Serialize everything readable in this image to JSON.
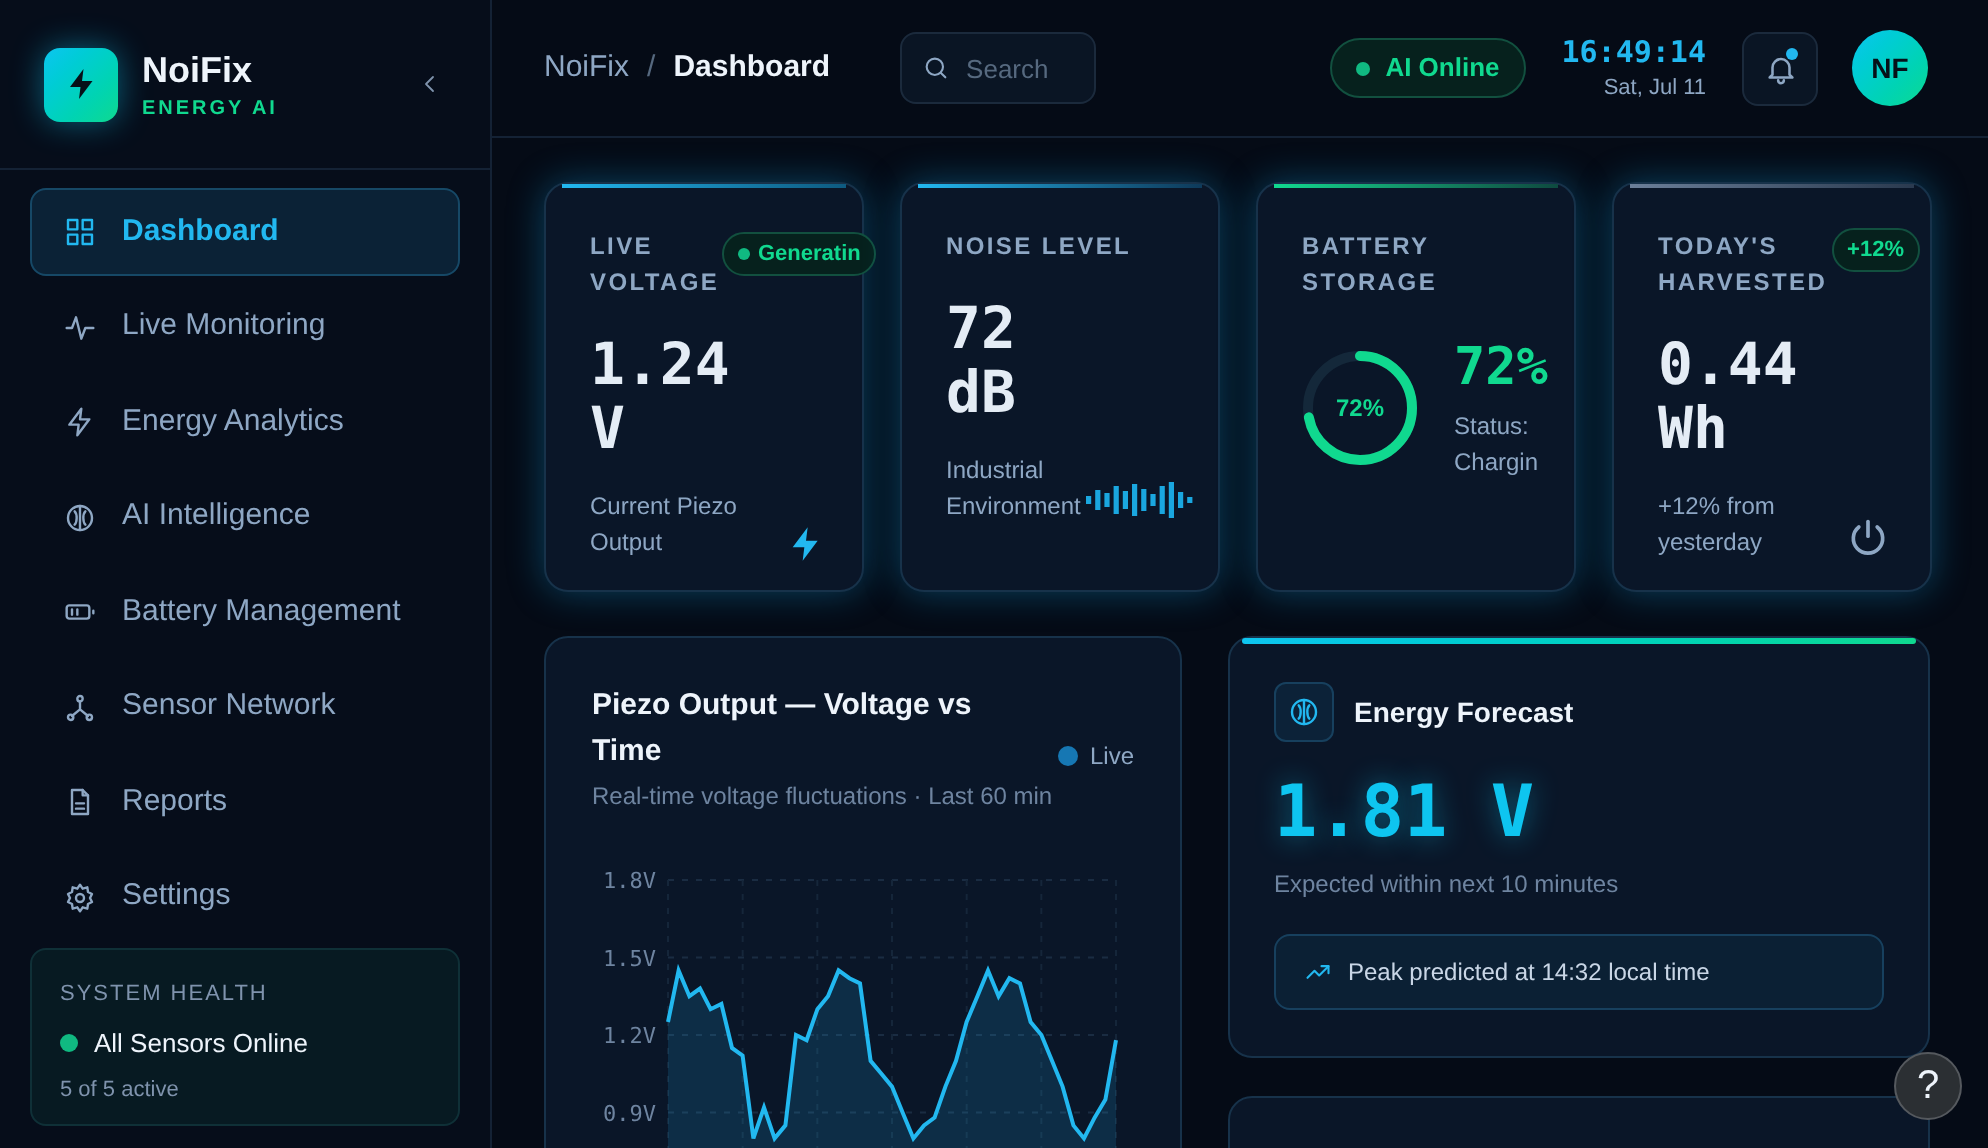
{
  "sidebar": {
    "brand": {
      "name": "NoiFix",
      "subtitle": "ENERGY AI"
    },
    "items": [
      {
        "label": "Dashboard",
        "selected": true
      },
      {
        "label": "Live Monitoring",
        "selected": false
      },
      {
        "label": "Energy Analytics",
        "selected": false
      },
      {
        "label": "AI Intelligence",
        "selected": false
      },
      {
        "label": "Battery Management",
        "selected": false
      },
      {
        "label": "Sensor Network",
        "selected": false
      },
      {
        "label": "Reports",
        "selected": false
      },
      {
        "label": "Settings",
        "selected": false
      }
    ],
    "system_health": {
      "title": "SYSTEM HEALTH",
      "status": "All Sensors Online",
      "color": "#10b981",
      "detail": "5 of 5 active"
    }
  },
  "header": {
    "breadcrumb": [
      "NoiFix",
      "/",
      "Dashboard"
    ],
    "search": {
      "placeholder": "Search"
    },
    "ai_status": "AI Online",
    "time": "16:49:14",
    "date": "Sat, Jul 11",
    "notifications": {
      "unread": true
    },
    "avatar": "NF"
  },
  "stat_cards": [
    {
      "kind": "voltage",
      "title": "LIVE VOLTAGE",
      "badge": {
        "text": "Generatin",
        "dot": true
      },
      "value": "1.24 V",
      "note": "Current Piezo Output"
    },
    {
      "kind": "noise",
      "title": "NOISE LEVEL",
      "value": "72 dB",
      "note": "Industrial Environment"
    },
    {
      "kind": "battery",
      "title": "BATTERY STORAGE",
      "level": 0.72,
      "ring_label": "72%",
      "value": "72%",
      "note": "Status: Chargin"
    },
    {
      "kind": "harvested",
      "title": "TODAY'S HARVESTED",
      "badge": {
        "text": "+12%",
        "dot": false
      },
      "value": "0.44 Wh",
      "note": "+12% from yesterday"
    }
  ],
  "voltage_chart": {
    "title": "Piezo Output — Voltage vs Time",
    "subtitle": "Real-time voltage fluctuations · Last 60 min",
    "chart_data": {
      "type": "area",
      "grid": true,
      "ylim": [
        0.6,
        1.8
      ],
      "yticks": [
        {
          "value": 1.8,
          "label": "1.8V"
        },
        {
          "value": 1.5,
          "label": "1.5V"
        },
        {
          "value": 1.2,
          "label": "1.2V"
        },
        {
          "value": 0.9,
          "label": "0.9V"
        }
      ],
      "series": [
        {
          "name": "Live",
          "color": "#22b8f0",
          "values": [
            1.25,
            1.45,
            1.35,
            1.38,
            1.3,
            1.32,
            1.15,
            1.12,
            0.8,
            0.92,
            0.8,
            0.85,
            1.2,
            1.18,
            1.3,
            1.35,
            1.45,
            1.42,
            1.4,
            1.1,
            1.05,
            1.0,
            0.9,
            0.8,
            0.85,
            0.88,
            1.0,
            1.1,
            1.25,
            1.35,
            1.45,
            1.35,
            1.42,
            1.4,
            1.25,
            1.2,
            1.1,
            1.0,
            0.85,
            0.8,
            0.88,
            0.95,
            1.18
          ]
        }
      ]
    }
  },
  "forecast": {
    "title": "Energy Forecast",
    "value": "1.81 V",
    "note": "Expected within next 10 minutes",
    "callout": "Peak predicted at 14:32 local time"
  },
  "help_button": "?"
}
